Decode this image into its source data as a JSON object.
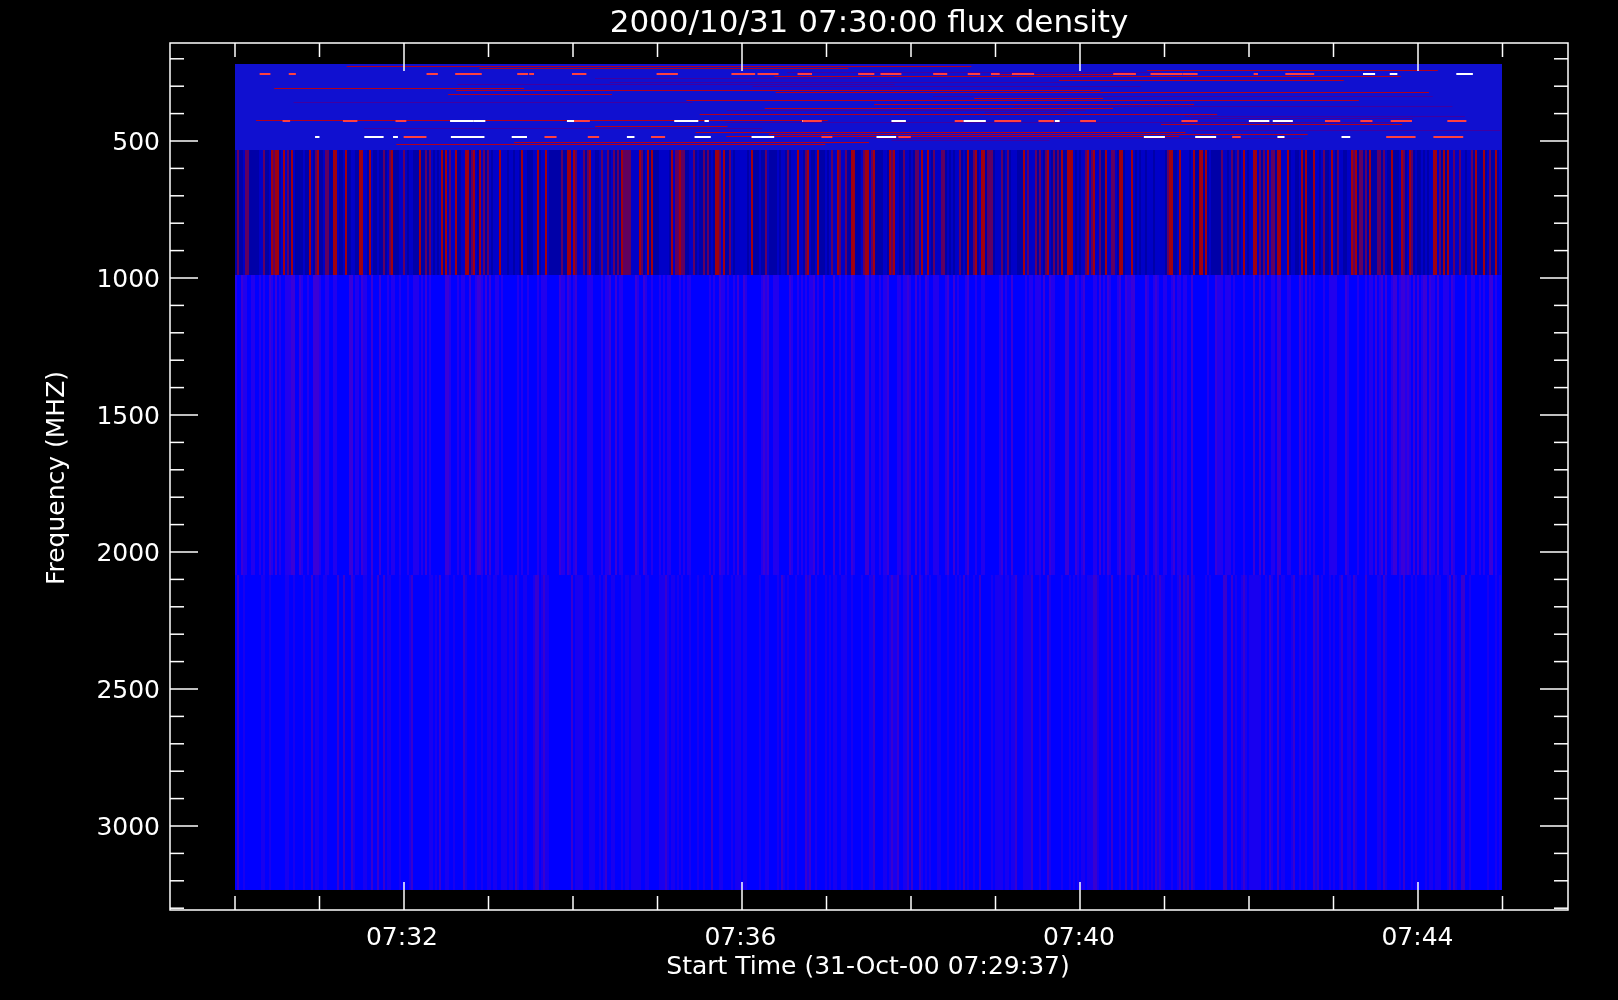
{
  "title": "2000/10/31 07:30:00 flux density",
  "x_axis": {
    "label": "Start Time (31-Oct-00 07:29:37)",
    "tick_labels": [
      "07:32",
      "07:36",
      "07:40",
      "07:44"
    ]
  },
  "y_axis": {
    "label": "Frequency (MHZ)",
    "tick_labels": [
      "500",
      "1000",
      "1500",
      "2000",
      "2500",
      "3000"
    ]
  }
}
